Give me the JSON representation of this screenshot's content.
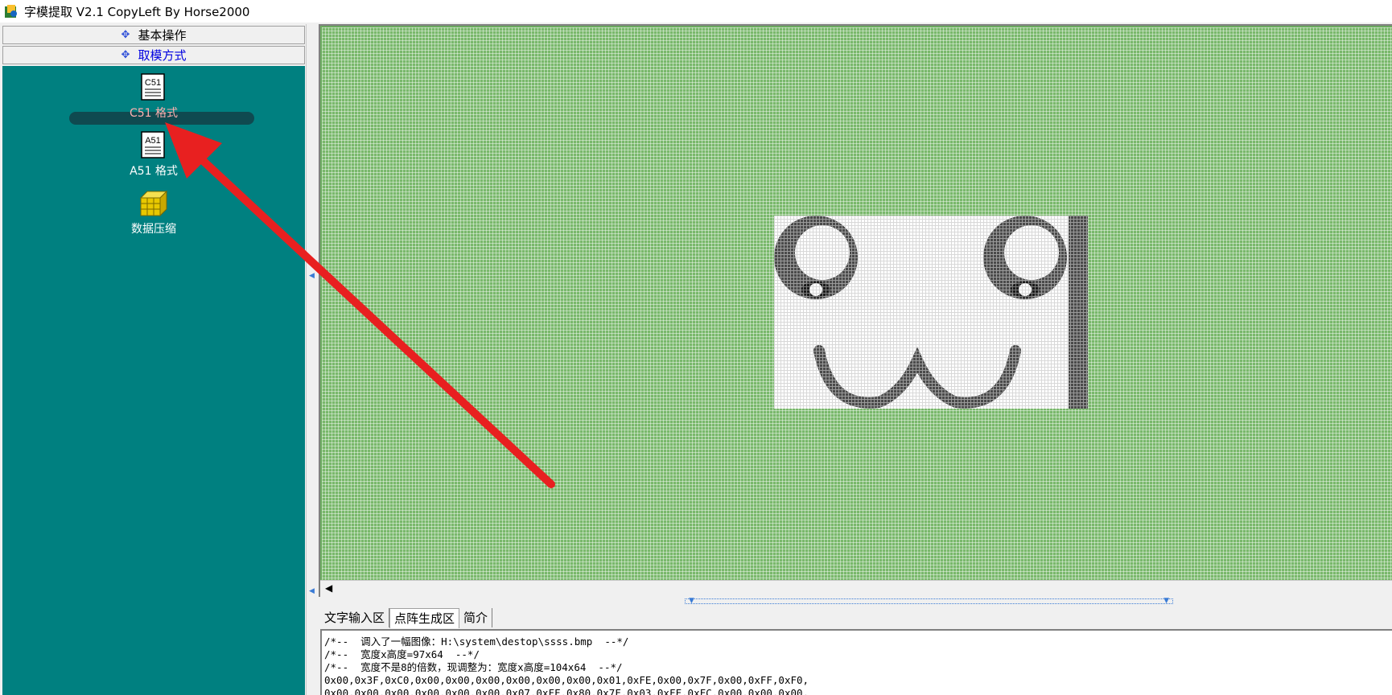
{
  "window": {
    "title": "字模提取 V2.1  CopyLeft By Horse2000"
  },
  "sidebar": {
    "headers": [
      {
        "label": "基本操作"
      },
      {
        "label": "取模方式"
      }
    ],
    "tools": [
      {
        "label": "C51 格式",
        "icon_text": "C51",
        "selected": true
      },
      {
        "label": "A51 格式",
        "icon_text": "A51",
        "selected": false
      },
      {
        "label": "数据压缩",
        "icon_text": "",
        "selected": false
      }
    ]
  },
  "tabs": [
    {
      "label": "文字输入区"
    },
    {
      "label": "点阵生成区"
    },
    {
      "label": "简介"
    }
  ],
  "code_lines": [
    "/*--  调入了一幅图像：H:\\system\\destop\\ssss.bmp  --*/",
    "/*--  宽度x高度=97x64  --*/",
    "/*--  宽度不是8的倍数，现调整为：宽度x高度=104x64  --*/",
    "0x00,0x3F,0xC0,0x00,0x00,0x00,0x00,0x00,0x00,0x01,0xFE,0x00,0x7F,0x00,0xFF,0xF0,",
    "0x00,0x00,0x00,0x00,0x00,0x00,0x07,0xFF,0x80,0x7F,0x03,0xFF,0xFC,0x00,0x00,0x00,"
  ],
  "colors": {
    "teal": "#008080",
    "grid_green": "#79b86b",
    "arrow_red": "#e82020",
    "header_blue": "#0000e0"
  }
}
